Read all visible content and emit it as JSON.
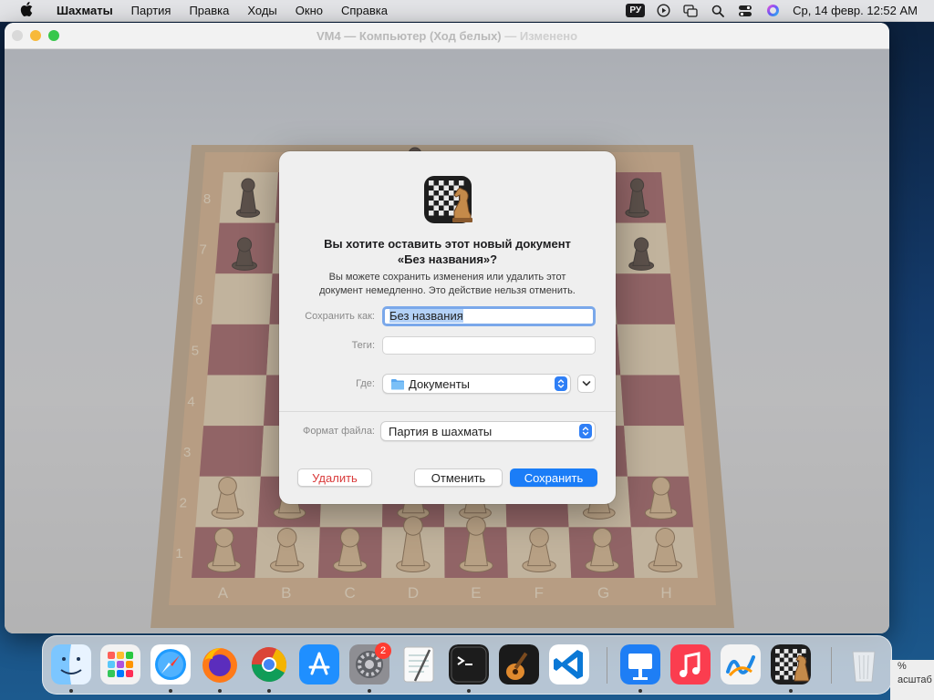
{
  "menubar": {
    "app": "Шахматы",
    "items": [
      "Партия",
      "Правка",
      "Ходы",
      "Окно",
      "Справка"
    ],
    "input_source": "РУ",
    "clock": "Ср, 14 февр.  12:52 AM"
  },
  "window": {
    "title": "VM4 — Компьютер  (Ход белых)",
    "title_edited": " — Изменено"
  },
  "board": {
    "ranks": [
      "8",
      "7",
      "6",
      "5",
      "4",
      "3",
      "2",
      "1"
    ],
    "files": [
      "A",
      "B",
      "C",
      "D",
      "E",
      "F",
      "G",
      "H"
    ]
  },
  "dialog": {
    "title_line1": "Вы хотите оставить этот новый документ",
    "title_line2": "«Без названия»?",
    "message_line1": "Вы можете сохранить изменения или удалить этот",
    "message_line2": "документ немедленно. Это действие нельзя отменить.",
    "save_as_label": "Сохранить как:",
    "save_as_value": "Без названия",
    "tags_label": "Теги:",
    "tags_value": "",
    "where_label": "Где:",
    "where_value": "Документы",
    "format_label": "Формат файла:",
    "format_value": "Партия в шахматы",
    "delete_button": "Удалить",
    "cancel_button": "Отменить",
    "save_button": "Сохранить"
  },
  "dock": {
    "apps": [
      {
        "name": "finder-icon"
      },
      {
        "name": "launchpad-icon"
      },
      {
        "name": "safari-icon"
      },
      {
        "name": "firefox-icon"
      },
      {
        "name": "chrome-icon"
      },
      {
        "name": "app-store-icon"
      },
      {
        "name": "system-settings-icon",
        "badge": "2"
      },
      {
        "name": "textedit-icon"
      },
      {
        "name": "terminal-icon"
      },
      {
        "name": "garageband-icon"
      },
      {
        "name": "vscode-icon"
      },
      {
        "name": "keynote-icon"
      },
      {
        "name": "music-icon"
      },
      {
        "name": "freeform-icon"
      },
      {
        "name": "chess-icon"
      },
      {
        "name": "trash-icon"
      }
    ],
    "settings_badge": "2"
  },
  "background_window_peek": {
    "line1": "%",
    "line2": "асштаб"
  }
}
